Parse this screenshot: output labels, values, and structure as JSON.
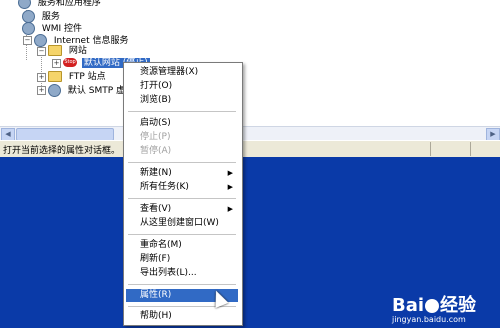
{
  "tree": {
    "nodes": [
      {
        "label": "服务和应用程序"
      },
      {
        "label": "服务"
      },
      {
        "label": "WMI 控件"
      },
      {
        "label": "Internet 信息服务"
      },
      {
        "label": "网站"
      },
      {
        "label": "默认网站 (停止)",
        "state_badge": "Stop"
      },
      {
        "label": "FTP 站点"
      },
      {
        "label": "默认 SMTP 虚拟"
      }
    ]
  },
  "statusbar": {
    "text": "打开当前选择的属性对话框。"
  },
  "context_menu": {
    "items": [
      {
        "label": "资源管理器(X)"
      },
      {
        "label": "打开(O)"
      },
      {
        "label": "浏览(B)"
      },
      {
        "label": "启动(S)"
      },
      {
        "label": "停止(P)"
      },
      {
        "label": "暂停(A)"
      },
      {
        "label": "新建(N)"
      },
      {
        "label": "所有任务(K)"
      },
      {
        "label": "查看(V)"
      },
      {
        "label": "从这里创建窗口(W)"
      },
      {
        "label": "重命名(M)"
      },
      {
        "label": "刷新(F)"
      },
      {
        "label": "导出列表(L)..."
      },
      {
        "label": "属性(R)"
      },
      {
        "label": "帮助(H)"
      }
    ]
  },
  "watermark": {
    "logo": "Bai",
    "logo_suffix": "经验",
    "url": "jingyan.baidu.com"
  }
}
